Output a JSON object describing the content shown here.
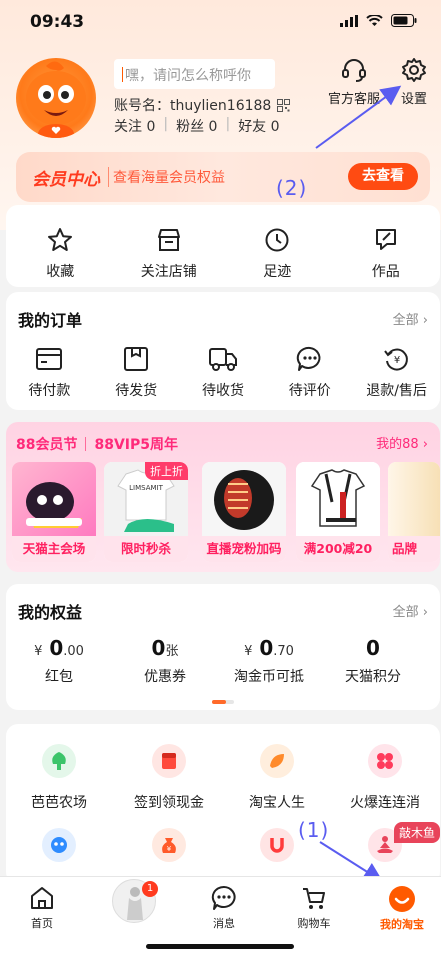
{
  "status": {
    "time": "09:43"
  },
  "profile": {
    "nickname_placeholder": "嘿，请问怎么称呼你",
    "account": "账号名：thuylien16188",
    "stats": [
      {
        "label": "关注",
        "value": "0"
      },
      {
        "label": "粉丝",
        "value": "0"
      },
      {
        "label": "好友",
        "value": "0"
      }
    ]
  },
  "top_actions": {
    "service": "官方客服",
    "settings": "设置"
  },
  "member": {
    "title": "会员中心",
    "subtitle": "查看海量会员权益",
    "button": "去查看"
  },
  "annotations": {
    "a1": "(1)",
    "a2": "(2)"
  },
  "quick": [
    {
      "icon": "star-icon",
      "label": "收藏"
    },
    {
      "icon": "store-icon",
      "label": "关注店铺"
    },
    {
      "icon": "clock-icon",
      "label": "足迹"
    },
    {
      "icon": "edit-icon",
      "label": "作品"
    }
  ],
  "orders": {
    "title": "我的订单",
    "more": "全部 ›",
    "items": [
      {
        "icon": "wallet-icon",
        "label": "待付款"
      },
      {
        "icon": "package-icon",
        "label": "待发货"
      },
      {
        "icon": "truck-icon",
        "label": "待收货"
      },
      {
        "icon": "chat-icon",
        "label": "待评价"
      },
      {
        "icon": "refund-icon",
        "label": "退款/售后"
      }
    ]
  },
  "vip": {
    "brand1": "88会员节",
    "brand2": "88VIP5周年",
    "more": "我的88 ›",
    "products": [
      {
        "label": "天猫主会场",
        "tag": ""
      },
      {
        "label": "限时秒杀",
        "tag": "折上折"
      },
      {
        "label": "直播宠粉加码",
        "tag": ""
      },
      {
        "label": "满200减20",
        "tag": ""
      },
      {
        "label": "品牌",
        "tag": ""
      }
    ]
  },
  "benefits": {
    "title": "我的权益",
    "more": "全部 ›",
    "items": [
      {
        "prefix": "¥",
        "value": "0",
        "suffix": ".00",
        "label": "红包"
      },
      {
        "prefix": "",
        "value": "0",
        "suffix": "张",
        "label": "优惠券"
      },
      {
        "prefix": "¥",
        "value": "0",
        "suffix": ".70",
        "label": "淘金币可抵"
      },
      {
        "prefix": "",
        "value": "0",
        "suffix": "",
        "label": "天猫积分"
      }
    ]
  },
  "services": [
    {
      "icon": "farm-icon",
      "label": "芭芭农场",
      "color": "#3cc46a"
    },
    {
      "icon": "signin-icon",
      "label": "签到领现金",
      "color": "#ff4a3c"
    },
    {
      "icon": "taobao-life-icon",
      "label": "淘宝人生",
      "color": "#ff8a2a"
    },
    {
      "icon": "match-game-icon",
      "label": "火爆连连消",
      "color": "#ff3b5c"
    },
    {
      "icon": "robot-icon",
      "label": "",
      "color": "#2e8cff"
    },
    {
      "icon": "money-bag-icon",
      "label": "",
      "color": "#ff5a2a"
    },
    {
      "icon": "u-icon",
      "label": "",
      "color": "#ff3b3b"
    },
    {
      "icon": "meditation-icon",
      "label": "",
      "color": "#e8445a",
      "badge": "敲木鱼"
    }
  ],
  "tabbar": [
    {
      "icon": "home-icon",
      "label": "首页"
    },
    {
      "icon": "feed-icon",
      "label": "",
      "badge": "1"
    },
    {
      "icon": "message-icon",
      "label": "消息"
    },
    {
      "icon": "cart-icon",
      "label": "购物车"
    },
    {
      "icon": "my-taobao-icon",
      "label": "我的淘宝"
    }
  ]
}
